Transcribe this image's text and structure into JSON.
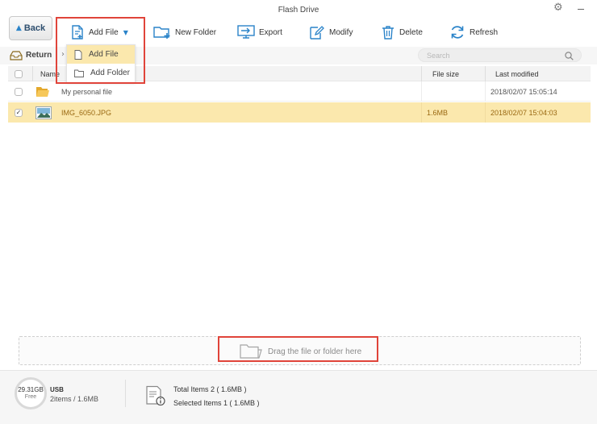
{
  "window": {
    "title": "Flash Drive"
  },
  "toolbar": {
    "back_label": "Back",
    "add_file_label": "Add File",
    "new_folder_label": "New Folder",
    "export_label": "Export",
    "modify_label": "Modify",
    "delete_label": "Delete",
    "refresh_label": "Refresh"
  },
  "add_menu": {
    "items": [
      {
        "label": "Add File",
        "icon": "file-icon",
        "highlighted": true
      },
      {
        "label": "Add Folder",
        "icon": "folder-icon",
        "highlighted": false
      }
    ]
  },
  "nav": {
    "return_label": "Return",
    "search_placeholder": "Search"
  },
  "table": {
    "columns": {
      "name": "Name",
      "size": "File size",
      "modified": "Last modified"
    },
    "rows": [
      {
        "name": "My personal file",
        "size": "",
        "modified": "2018/02/07 15:05:14",
        "type": "folder",
        "selected": false
      },
      {
        "name": "IMG_6050.JPG",
        "size": "1.6MB",
        "modified": "2018/02/07 15:04:03",
        "type": "image",
        "selected": true
      }
    ]
  },
  "dropzone": {
    "label": "Drag the file or folder here"
  },
  "footer": {
    "capacity": "29.31GB",
    "free_label": "Free",
    "device_name": "USB",
    "device_count": "2items / 1.6MB",
    "total_items": "Total Items 2 ( 1.6MB )",
    "selected_items": "Selected Items 1 ( 1.6MB )"
  },
  "colors": {
    "accent": "#2a83c9",
    "selection": "#fbe8ad",
    "selection_text": "#9a6912",
    "highlight_box": "#e0443a",
    "folder": "#f2c04c"
  }
}
